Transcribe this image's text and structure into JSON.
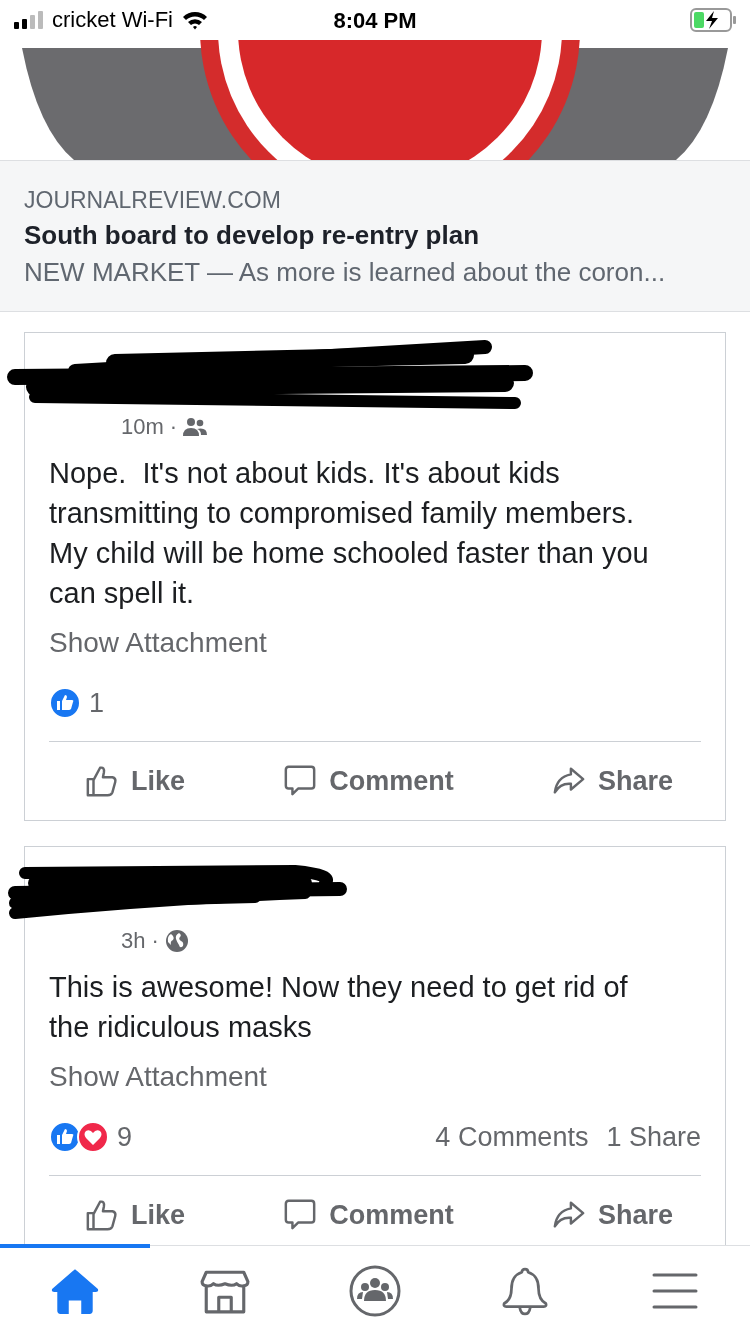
{
  "status_bar": {
    "carrier": "cricket Wi-Fi",
    "time": "8:04 PM",
    "charging": true
  },
  "link_preview": {
    "domain": "JOURNALREVIEW.COM",
    "title": "South board to develop re-entry plan",
    "snippet": "NEW MARKET — As more is learned about the coron..."
  },
  "posts": [
    {
      "time": "10m",
      "separator": "·",
      "audience": {
        "kind": "friends"
      },
      "text": "Nope.  It's not about kids. It's about kids transmitting to compromised family members. My child will be home schooled faster than you can spell it.",
      "attachment_link": "Show Attachment",
      "reactions": [
        {
          "kind": "like"
        }
      ],
      "reaction_count": "1",
      "actions": [
        {
          "kind": "like",
          "label": "Like"
        },
        {
          "kind": "comment",
          "label": "Comment"
        },
        {
          "kind": "share",
          "label": "Share"
        }
      ]
    },
    {
      "time": "3h",
      "separator": "·",
      "audience": {
        "kind": "public"
      },
      "text": "This is awesome! Now they need to get rid of the ridiculous masks",
      "attachment_link": "Show Attachment",
      "reactions": [
        {
          "kind": "like"
        },
        {
          "kind": "love"
        }
      ],
      "reaction_count": "9",
      "comments_count": "4 Comments",
      "shares_count": "1 Share",
      "actions": [
        {
          "kind": "like",
          "label": "Like"
        },
        {
          "kind": "comment",
          "label": "Comment"
        },
        {
          "kind": "share",
          "label": "Share"
        }
      ]
    }
  ],
  "nav": {
    "items": [
      {
        "kind": "home",
        "selected": true
      },
      {
        "kind": "marketplace",
        "selected": false
      },
      {
        "kind": "groups",
        "selected": false
      },
      {
        "kind": "notifications",
        "selected": false
      },
      {
        "kind": "menu",
        "selected": false
      }
    ]
  }
}
